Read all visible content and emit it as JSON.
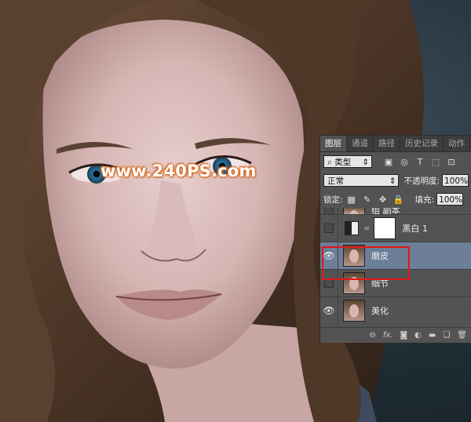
{
  "watermark": "www.240PS.com",
  "panel": {
    "tabs": [
      {
        "label": "图层",
        "active": true
      },
      {
        "label": "通道",
        "active": false
      },
      {
        "label": "路径",
        "active": false
      },
      {
        "label": "历史记录",
        "active": false
      },
      {
        "label": "动作",
        "active": false
      }
    ],
    "filter_kind": "类型",
    "filter_icons": [
      "image-filter-icon",
      "adjustment-filter-icon",
      "type-filter-icon",
      "shape-filter-icon",
      "smart-object-filter-icon"
    ],
    "blend_mode": "正常",
    "opacity_label": "不透明度:",
    "opacity_value": "100%",
    "lock_label": "锁定:",
    "fill_label": "填充:",
    "fill_value": "100%",
    "layers": [
      {
        "name": "组 副本",
        "visible": false,
        "kind": "pixel"
      },
      {
        "name": "黑白 1",
        "visible": false,
        "kind": "adjustment"
      },
      {
        "name": "磨皮",
        "visible": true,
        "kind": "pixel",
        "selected": true
      },
      {
        "name": "细节",
        "visible": false,
        "kind": "pixel"
      },
      {
        "name": "美化",
        "visible": true,
        "kind": "pixel"
      }
    ],
    "footer_icons": [
      "link-icon",
      "fx-icon",
      "mask-icon",
      "adjustment-icon",
      "folder-icon",
      "new-layer-icon",
      "trash-icon"
    ]
  },
  "colors": {
    "highlight": "#e01818",
    "selected_layer": "#6c7e98",
    "panel_bg": "#535353"
  }
}
